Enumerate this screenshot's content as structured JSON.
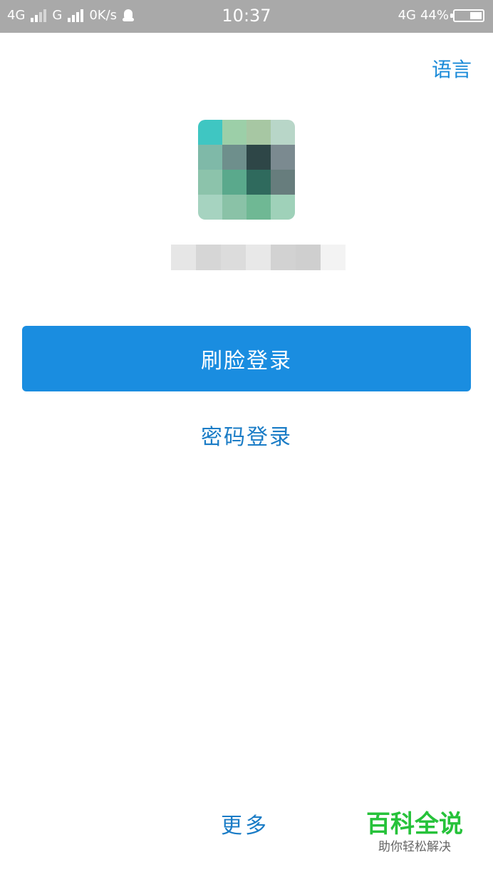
{
  "status_bar": {
    "network1": "4G",
    "network2": "G",
    "speed": "0K/s",
    "time": "10:37",
    "network3": "4G",
    "battery_text": "44%",
    "battery_level": 0.44,
    "icons": [
      "signal-icon",
      "signal-icon",
      "qq-icon",
      "battery-icon"
    ]
  },
  "header": {
    "language_label": "语言"
  },
  "profile": {
    "avatar_icon": "avatar-pixelated",
    "avatar_colors": [
      "#3fc6c2",
      "#9ccfa8",
      "#a7c7a3",
      "#b8d6c8",
      "#7fb9a8",
      "#6e8f8c",
      "#2e4647",
      "#7b8a90",
      "#8cc3ab",
      "#5aa98c",
      "#2f6a5d",
      "#677d7d",
      "#a6d3c0",
      "#8ac2a7",
      "#6fb894",
      "#9fd1b9"
    ],
    "username_mask_colors": [
      "#e6e6e6",
      "#d6d6d6",
      "#dcdcdc",
      "#e8e8e8",
      "#d2d2d2",
      "#cfcfcf",
      "#f3f3f3"
    ]
  },
  "actions": {
    "face_login": "刷脸登录",
    "password_login": "密码登录",
    "more": "更多"
  },
  "watermark": {
    "title": "百科全说",
    "subtitle": "助你轻松解决"
  },
  "colors": {
    "accent": "#1a8de0",
    "link": "#1a7cc6",
    "status_bar": "#a9a9a9",
    "watermark_green": "#26c23a"
  }
}
